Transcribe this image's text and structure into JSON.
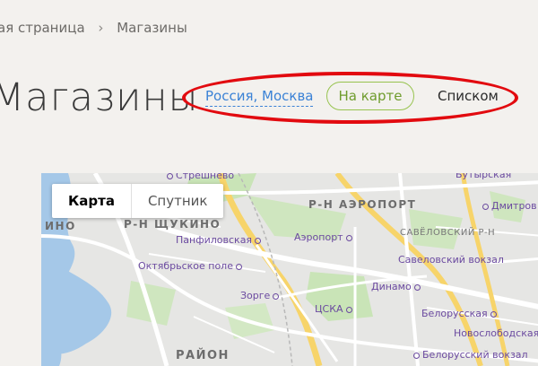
{
  "breadcrumb": {
    "home": "ая страница",
    "current": "Магазины"
  },
  "page": {
    "title": "Магазины"
  },
  "controls": {
    "city": "Россия, Москва",
    "map_view": "На карте",
    "list_view": "Списком"
  },
  "map": {
    "type_map": "Карта",
    "type_satellite": "Спутник",
    "labels": {
      "streshnevo": "Стрешнево",
      "butyrskaya": "Бутырская",
      "aeroport_district": "Р-Н АЭРОПОРТ",
      "dmitrovskaya": "Дмитров",
      "shchukino_district": "Р-Н ЩУКИНО",
      "panfilovskaya": "Панфиловская",
      "aeroport_station": "Аэропорт",
      "savelovsky_district": "САВЁЛОВСКИЙ Р-Н",
      "ino": "ИНО",
      "oktyabrskoe_pole": "Октябрьское поле",
      "savelovsky_vokzal": "Савеловский вокзал",
      "dinamo": "Динамо",
      "zorge": "Зорге",
      "belorusskaya": "Белорусская",
      "cska": "ЦСКА",
      "novoslobodskaya": "Новослободская",
      "rayon": "РАЙОН",
      "belorussky_vokzal": "Белорусский вокзал"
    }
  }
}
